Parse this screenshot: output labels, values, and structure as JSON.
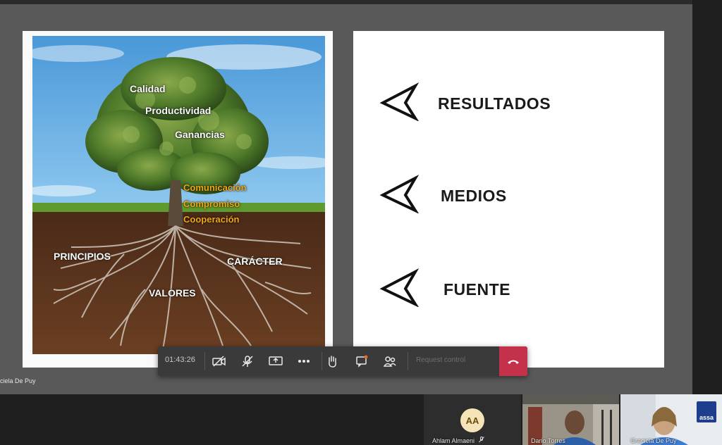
{
  "meeting": {
    "timer": "01:43:26",
    "request_control": "Request control",
    "presenter_name": "ciela De Puy"
  },
  "tree_slide": {
    "crown_labels": [
      "Calidad",
      "Productividad",
      "Ganancias"
    ],
    "trunk_labels": [
      "Comunicación",
      "Compromiso",
      "Cooperación"
    ],
    "root_labels": [
      "PRINCIPIOS",
      "CARÁCTER",
      "VALORES"
    ]
  },
  "arrow_slide": {
    "items": [
      "RESULTADOS",
      "MEDIOS",
      "FUENTE"
    ]
  },
  "gallery": {
    "participants": [
      {
        "initials": "AA",
        "name": "Ahlam Almaeni",
        "icon": "mic-off-icon"
      },
      {
        "name": "Dario Torres"
      },
      {
        "name": "Graciela De Puy",
        "logo_text": "assa"
      }
    ]
  },
  "colors": {
    "accent_gold": "#f2a817",
    "hangup_red": "#c4314b",
    "avatar_bg": "#f6e4b9"
  }
}
